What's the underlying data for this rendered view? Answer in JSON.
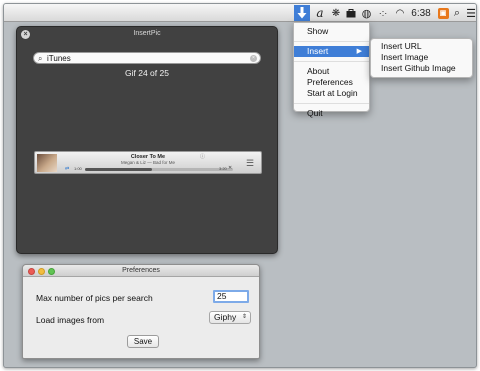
{
  "menubar": {
    "icons": [
      "download-arrow-icon",
      "script-a-icon",
      "paw-icon",
      "briefcase-icon",
      "globe-icon",
      "dots-icon",
      "wifi-icon",
      "orange-app-icon",
      "search-icon",
      "list-icon"
    ],
    "time": "6:38",
    "accent": "#3f7ed7"
  },
  "main_menu": {
    "items": [
      "Show",
      "Insert",
      "About",
      "Preferences",
      "Start at Login",
      "Quit"
    ]
  },
  "sub_menu": {
    "items": [
      "Insert URL",
      "Insert Image",
      "Insert Github Image"
    ]
  },
  "insertpic": {
    "title": "InsertPic",
    "search_value": "iTunes",
    "count_label": "Gif 24 of 25",
    "bg": "#414141"
  },
  "itunes": {
    "track_title": "Closer To Me",
    "track_sub": "Megan & Liz — Bad for Me",
    "elapsed": "1:00",
    "total": "3:20",
    "progress": 0.45
  },
  "prefs": {
    "title": "Preferences",
    "max_pics_label": "Max number of pics per search",
    "max_pics_value": "25",
    "load_from_label": "Load images from",
    "load_from_value": "Giphy",
    "save_label": "Save"
  }
}
